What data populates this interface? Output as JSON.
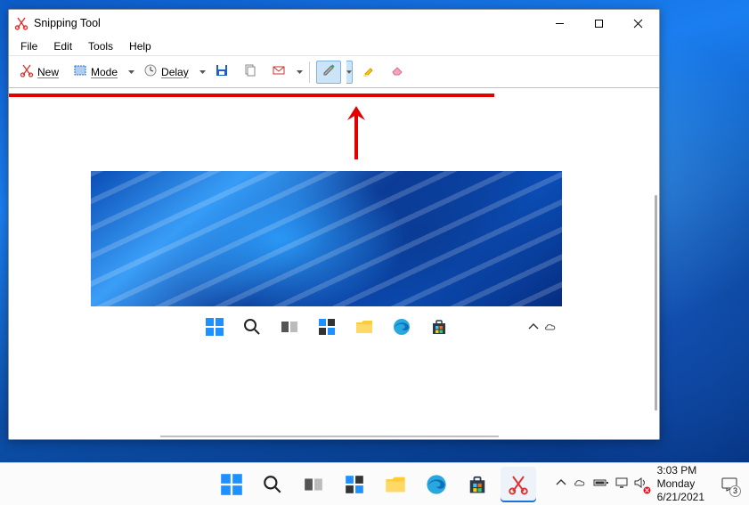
{
  "window": {
    "title": "Snipping Tool",
    "menus": [
      "File",
      "Edit",
      "Tools",
      "Help"
    ],
    "toolbar": {
      "new_label": "New",
      "mode_label": "Mode",
      "delay_label": "Delay"
    }
  },
  "annotations": {
    "line_color": "#e30000",
    "arrow_color": "#e30000"
  },
  "taskbar": {
    "clock_time": "3:03 PM",
    "clock_day": "Monday",
    "clock_date": "6/21/2021",
    "notification_count": "3"
  }
}
